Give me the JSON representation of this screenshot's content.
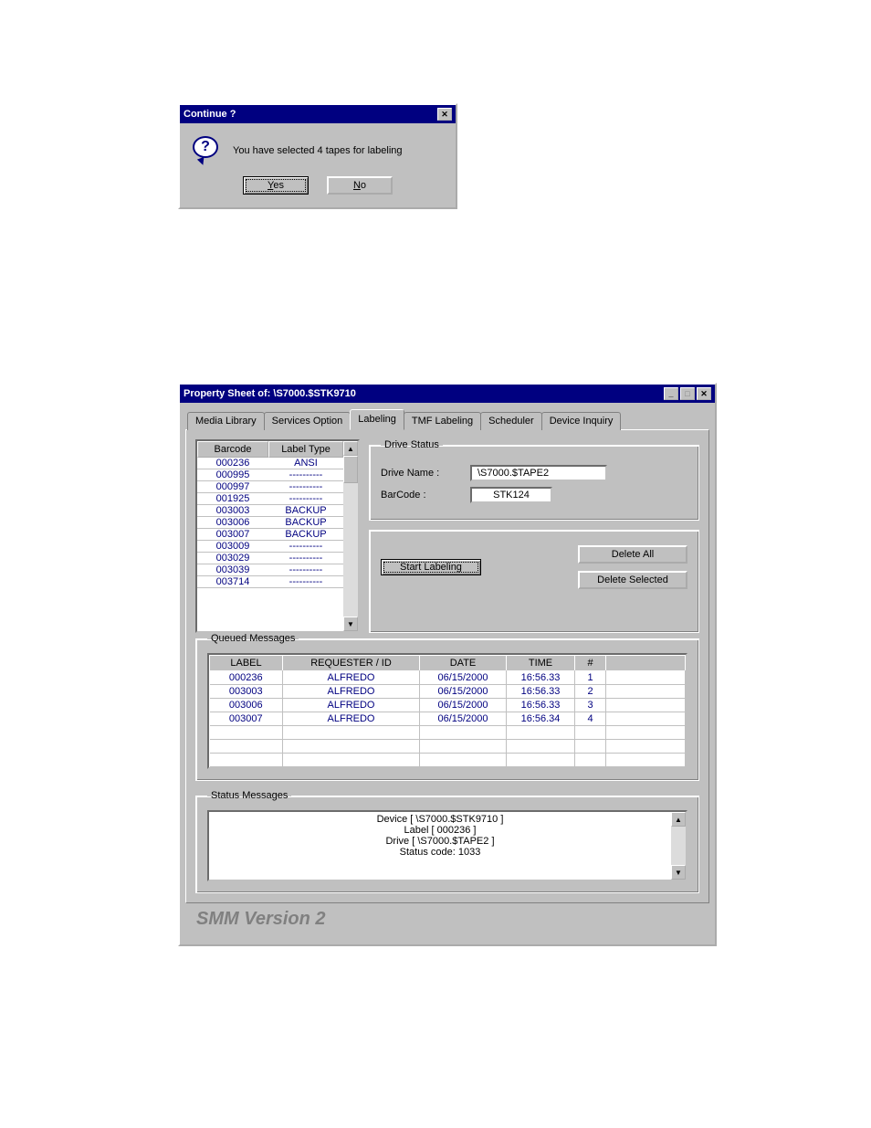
{
  "dialog": {
    "title": "Continue ?",
    "message": "You have selected 4 tapes for labeling",
    "yes": "Yes",
    "no": "No"
  },
  "prop": {
    "title": "Property Sheet of: \\S7000.$STK9710",
    "tabs": [
      "Media Library",
      "Services Option",
      "Labeling",
      "TMF Labeling",
      "Scheduler",
      "Device Inquiry"
    ],
    "active_tab": 2,
    "barcode_header": "Barcode",
    "labeltype_header": "Label Type",
    "barcode_rows": [
      {
        "barcode": "000236",
        "labeltype": "ANSI"
      },
      {
        "barcode": "000995",
        "labeltype": "----------"
      },
      {
        "barcode": "000997",
        "labeltype": "----------"
      },
      {
        "barcode": "001925",
        "labeltype": "----------"
      },
      {
        "barcode": "003003",
        "labeltype": "BACKUP"
      },
      {
        "barcode": "003006",
        "labeltype": "BACKUP"
      },
      {
        "barcode": "003007",
        "labeltype": "BACKUP"
      },
      {
        "barcode": "003009",
        "labeltype": "----------"
      },
      {
        "barcode": "003029",
        "labeltype": "----------"
      },
      {
        "barcode": "003039",
        "labeltype": "----------"
      },
      {
        "barcode": "003714",
        "labeltype": "----------"
      }
    ],
    "drive_status": {
      "legend": "Drive Status",
      "drive_name_label": "Drive Name :",
      "drive_name": "\\S7000.$TAPE2",
      "barcode_label": "BarCode :",
      "barcode": "STK124"
    },
    "start_labeling": "Start Labeling",
    "delete_all": "Delete All",
    "delete_selected": "Delete Selected",
    "queued": {
      "legend": "Queued Messages",
      "headers": [
        "LABEL",
        "REQUESTER / ID",
        "DATE",
        "TIME",
        "#",
        ""
      ],
      "rows": [
        {
          "label": "000236",
          "requester": "ALFREDO",
          "date": "06/15/2000",
          "time": "16:56.33",
          "num": "1"
        },
        {
          "label": "003003",
          "requester": "ALFREDO",
          "date": "06/15/2000",
          "time": "16:56.33",
          "num": "2"
        },
        {
          "label": "003006",
          "requester": "ALFREDO",
          "date": "06/15/2000",
          "time": "16:56.33",
          "num": "3"
        },
        {
          "label": "003007",
          "requester": "ALFREDO",
          "date": "06/15/2000",
          "time": "16:56.34",
          "num": "4"
        }
      ]
    },
    "status": {
      "legend": "Status Messages",
      "lines": [
        "Device [ \\S7000.$STK9710 ]",
        "Label [ 000236 ]",
        "Drive [ \\S7000.$TAPE2 ]",
        "Status code: 1033"
      ]
    },
    "version": "SMM Version 2"
  }
}
